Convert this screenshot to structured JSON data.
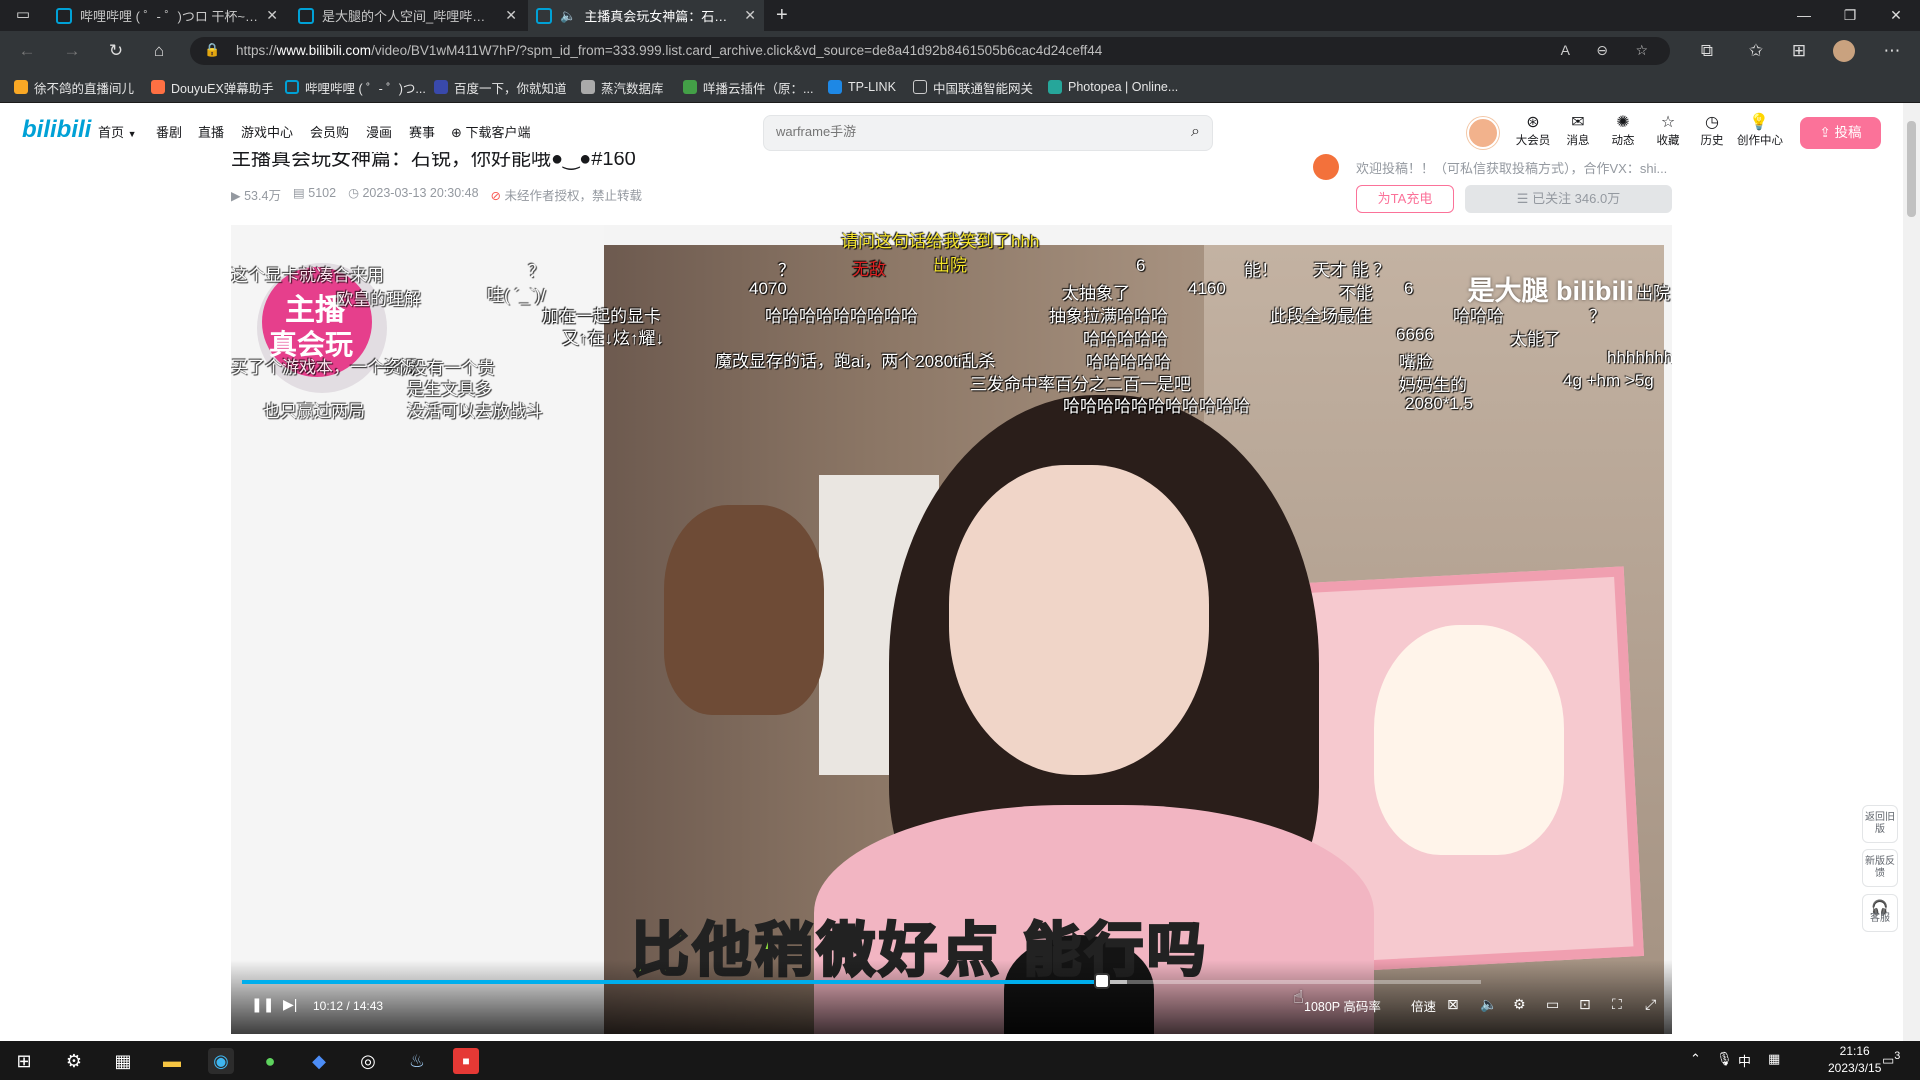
{
  "browser": {
    "tabs": [
      {
        "title": "哔哩哔哩 ( ゜- ゜)つロ 干杯~-bili",
        "active": false
      },
      {
        "title": "是大腿的个人空间_哔哩哔哩_bili",
        "active": false
      },
      {
        "title": "主播真会玩女神篇：石锐。",
        "active": true
      }
    ],
    "new_tab": "+",
    "url_prefix": "https://",
    "url_domain": "www.bilibili.com",
    "url_path": "/video/BV1wM411W7hP/?spm_id_from=333.999.list.card_archive.click&vd_source=de8a41d92b8461505b6cac4d24ceff44",
    "bookmarks": [
      "徐不鸽的直播间儿",
      "DouyuEX弹幕助手",
      "哔哩哔哩 ( ゜- ゜)つ...",
      "百度一下，你就知道",
      "蒸汽数据库",
      "咩播云插件（原：...",
      "TP-LINK",
      "中国联通智能网关",
      "Photopea | Online..."
    ]
  },
  "site": {
    "logo": "bilibili",
    "nav": [
      "首页",
      "番剧",
      "直播",
      "游戏中心",
      "会员购",
      "漫画",
      "赛事",
      "下载客户端"
    ],
    "search_placeholder": "warframe手游",
    "header_icons": [
      "大会员",
      "消息",
      "动态",
      "收藏",
      "历史",
      "创作中心"
    ],
    "upload_label": "投稿"
  },
  "video": {
    "title": "主播真会玩女神篇：石锐，你好能哦●‿●#160",
    "views": "53.4万",
    "danmaku_count": "5102",
    "date": "2023-03-13 20:30:48",
    "copyright": "未经作者授权，禁止转载",
    "up_desc": "欢迎投稿！！（可私信获取投稿方式），合作VX：shi...",
    "charge_label": "为TA充电",
    "follow_label": "已关注 346.0万"
  },
  "player": {
    "watermark": "是大腿 bilibili",
    "badge_line1": "主播",
    "badge_line2": "真会玩",
    "subtitle": "比他稍微好点 能行吗",
    "time": "10:12 / 14:43",
    "progress": 0.694,
    "quality": "1080P 高码率",
    "speed": "倍速",
    "danmaku": [
      "这个显卡就凑合来用",
      "欧皇的理解",
      "买了个游戏本，一个资源",
      "也只赢过两局",
      "？",
      "哇( ´_`)/",
      "加在一起的显卡",
      "又↑在↓炫↑耀↓",
      "一个没有一个贵",
      "是生文具多",
      "没活可以去放战斗",
      "请问这句话给我笑到了hhh",
      "无敌",
      "出院",
      "？",
      "4070",
      "哈哈哈哈哈哈哈哈哈",
      "魔改显存的话，跑ai，两个2080ti乱杀",
      "三发命中率百分之二百一是吧",
      "6",
      "太抽象了",
      "4160",
      "抽象拉满哈哈哈",
      "哈哈哈哈哈",
      "哈哈哈哈哈",
      "哈哈哈哈哈哈哈哈哈哈哈",
      "能！",
      "天才 能 ？",
      "不能",
      "6",
      "此段全场最佳",
      "哈哈哈",
      "6666",
      "太能了",
      "嘴脸",
      "妈妈生的",
      "2080*1.5",
      "？",
      "hhhhhhh",
      "4g +hm >5g",
      "出院"
    ]
  },
  "side_tools": [
    "返回旧版",
    "新版反馈",
    "客服"
  ],
  "taskbar": {
    "tray_lang": "中",
    "time": "21:16",
    "date": "2023/3/15",
    "notifications": "3"
  }
}
